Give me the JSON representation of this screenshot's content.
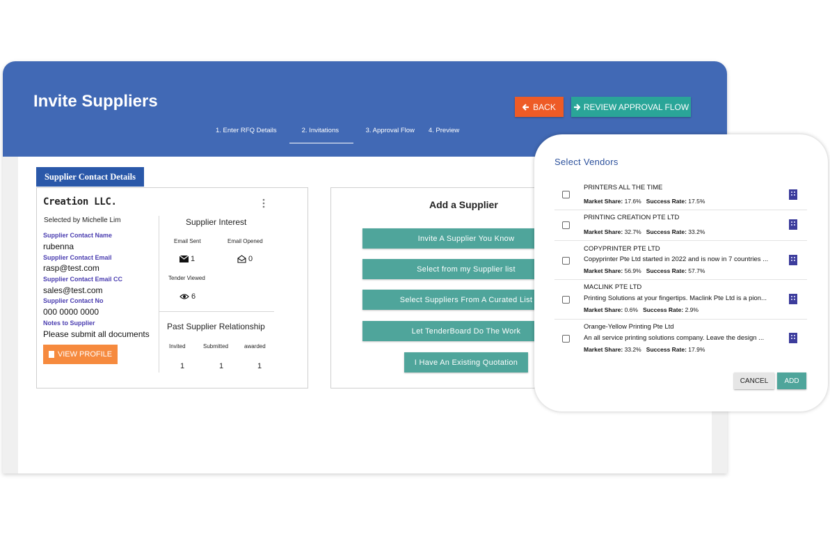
{
  "header": {
    "title": "Invite Suppliers",
    "back_label": "BACK",
    "review_label": "REVIEW APPROVAL FLOW",
    "steps": [
      "1. Enter RFQ Details",
      "2. Invitations",
      "3. Approval Flow",
      "4. Preview"
    ],
    "active_step": 1
  },
  "supplier_card": {
    "tab_label": "Supplier Contact Details",
    "company": "Creation LLC.",
    "selected_by": "Selected by Michelle Lim",
    "fields": [
      {
        "label": "Supplier Contact Name",
        "value": "rubenna"
      },
      {
        "label": "Supplier Contact Email",
        "value": "rasp@test.com"
      },
      {
        "label": "Supplier Contact Email CC",
        "value": "sales@test.com"
      },
      {
        "label": "Supplier Contact No",
        "value": "000 0000 0000"
      },
      {
        "label": "Notes to Supplier",
        "value": "Please submit all documents"
      }
    ],
    "view_profile_label": "VIEW PROFILE",
    "interest": {
      "title": "Supplier Interest",
      "email_sent_label": "Email Sent",
      "email_sent_value": "1",
      "email_opened_label": "Email Opened",
      "email_opened_value": "0",
      "tender_viewed_label": "Tender Viewed",
      "tender_viewed_value": "6"
    },
    "past": {
      "title": "Past Supplier Relationship",
      "columns": [
        "Invited",
        "Submitted",
        "awarded"
      ],
      "values": [
        "1",
        "1",
        "1"
      ]
    }
  },
  "add_supplier": {
    "title": "Add a Supplier",
    "buttons": [
      "Invite A Supplier You Know",
      "Select from my Supplier list",
      "Select Suppliers From A Curated List",
      "Let TenderBoard Do The Work",
      "I Have An Existing Quotation"
    ]
  },
  "modal": {
    "title": "Select Vendors",
    "market_share_label": "Market Share:",
    "success_rate_label": "Success Rate:",
    "vendors": [
      {
        "name": "PRINTERS ALL THE TIME",
        "desc": "",
        "market_share": "17.6%",
        "success_rate": "17.5%"
      },
      {
        "name": "PRINTING CREATION PTE LTD",
        "desc": "",
        "market_share": "32.7%",
        "success_rate": "33.2%"
      },
      {
        "name": "COPYPRINTER PTE LTD",
        "desc": "Copyprinter Pte Ltd started in 2022 and is now in 7 countries ...",
        "market_share": "56.9%",
        "success_rate": "57.7%"
      },
      {
        "name": "MACLINK PTE LTD",
        "desc": "Printing Solutions at your fingertips. Maclink Pte Ltd is a pion...",
        "market_share": "0.6%",
        "success_rate": "2.9%"
      },
      {
        "name": "Orange-Yellow Printing Pte Ltd",
        "desc": "An all service printing solutions company. Leave the design ...",
        "market_share": "33.2%",
        "success_rate": "17.9%"
      }
    ],
    "cancel_label": "CANCEL",
    "add_label": "ADD"
  },
  "colors": {
    "header": "#4169b5",
    "back": "#ee5b26",
    "teal": "#2aa598",
    "button_teal": "#4fa59b",
    "orange": "#f68a3e",
    "label_purple": "#4a3db0"
  }
}
